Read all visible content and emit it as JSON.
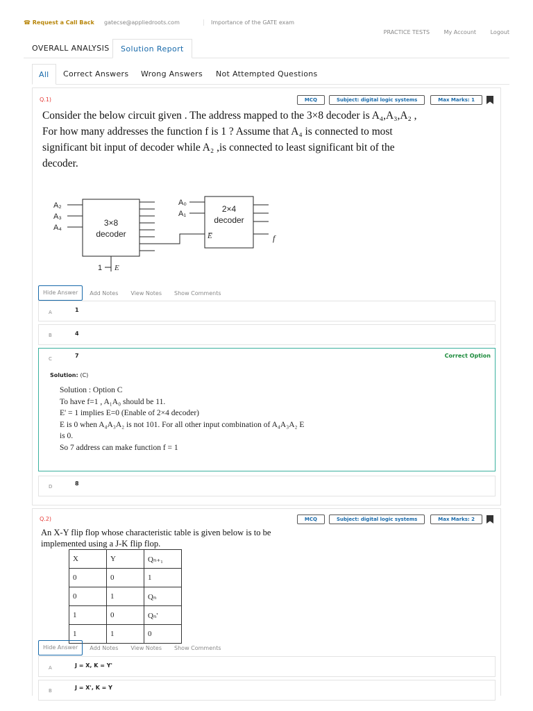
{
  "header": {
    "call_back": "Request a Call Back",
    "email": "gatecse@appliedroots.com",
    "link": "Importance of the GATE exam",
    "nav": [
      "PRACTICE TESTS",
      "My Account",
      "Logout"
    ]
  },
  "tabs": {
    "overall": "OVERALL ANALYSIS",
    "solution": "Solution Report"
  },
  "filters": [
    "All",
    "Correct Answers",
    "Wrong Answers",
    "Not Attempted Questions"
  ],
  "actions": {
    "hide": "Hide Answer",
    "add": "Add Notes",
    "view": "View Notes",
    "comments": "Show Comments"
  },
  "q1": {
    "num": "Q.1)",
    "type": "MCQ",
    "subject": "Subject: digital logic systems",
    "marks": "Max Marks: 1",
    "text": "Consider the below circuit given . The address mapped to the 3×8 decoder is A₄,A₃,A₂ , For how many addresses the function f is 1 ? Assume that A₄ is connected to most significant bit input of decoder while A₂ ,is connected to least significant bit of the decoder.",
    "diagram": {
      "in1": "A₂",
      "in2": "A₃",
      "in3": "A₄",
      "dec1": "3×8",
      "dec1b": "decoder",
      "enable": "1",
      "en_label": "E",
      "b0": "A₀",
      "b1": "A₁",
      "dec2": "2×4",
      "dec2b": "decoder",
      "en2": "E̅",
      "out": "f"
    },
    "options": [
      {
        "letter": "A",
        "value": "1"
      },
      {
        "letter": "B",
        "value": "4"
      },
      {
        "letter": "C",
        "value": "7"
      },
      {
        "letter": "D",
        "value": "8"
      }
    ],
    "correct_label": "Correct Option",
    "solution_title": "Solution:",
    "solution_key": "(C)",
    "solution_lines": [
      "Solution : Option C",
      "To have f=1 , A₁A₀ should be 11.",
      "E' = 1 implies E=0 (Enable of 2×4 decoder)",
      "E is 0 when A₄A₃A₂ is not 101. For all other input combination of A₄A₃A₂ E",
      "is 0.",
      "So 7 address can make function f = 1"
    ]
  },
  "q2": {
    "num": "Q.2)",
    "type": "MCQ",
    "subject": "Subject: digital logic systems",
    "marks": "Max Marks: 2",
    "text1": "An X-Y flip flop whose characteristic table is given below is to be",
    "text2": "implemented using a J-K flip flop.",
    "table": [
      [
        "X",
        "Y",
        "Qₙ₊₁"
      ],
      [
        "0",
        "0",
        "1"
      ],
      [
        "0",
        "1",
        "Qₙ"
      ],
      [
        "1",
        "0",
        "Qₙ'"
      ],
      [
        "1",
        "1",
        "0"
      ]
    ],
    "options": [
      {
        "letter": "A",
        "value": "J = X, K = Y'"
      },
      {
        "letter": "B",
        "value": "J = X', K = Y"
      }
    ]
  }
}
